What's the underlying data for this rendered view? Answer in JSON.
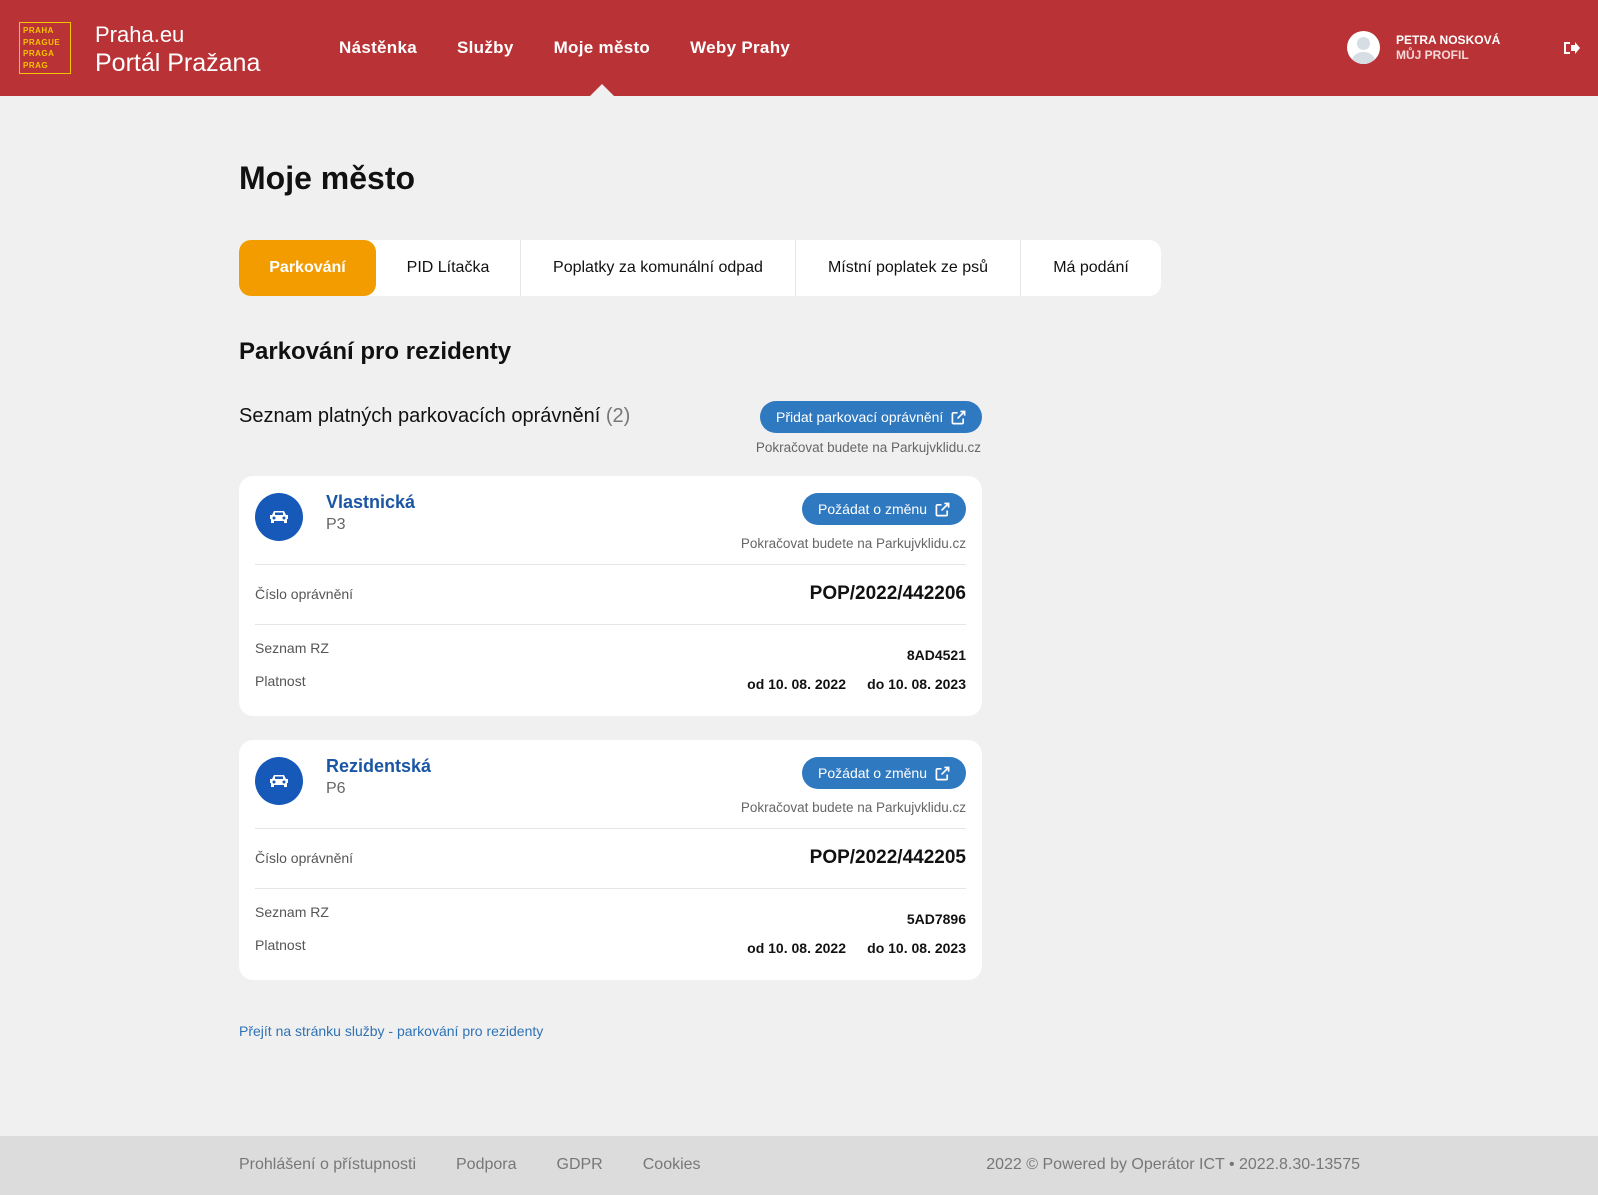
{
  "header": {
    "logo_lines": [
      "PRAHA",
      "PRAGUE",
      "PRAGA",
      "PRAG"
    ],
    "brand_line1": "Praha.eu",
    "brand_line2": "Portál Pražana",
    "nav": [
      "Nástěnka",
      "Služby",
      "Moje město",
      "Weby Prahy"
    ],
    "user_name": "PETRA NOSKOVÁ",
    "user_profile": "MŮJ PROFIL"
  },
  "main": {
    "title": "Moje město",
    "tabs": [
      "Parkování",
      "PID Lítačka",
      "Poplatky za komunální odpad",
      "Místní poplatek ze psů",
      "Má podání"
    ],
    "section_title": "Parkování pro rezidenty",
    "list_title": "Seznam platných parkovacích oprávnění",
    "list_count": "(2)",
    "add_button": "Přidat parkovací oprávnění",
    "continue_note": "Pokračovat budete na Parkujvklidu.cz",
    "permits": [
      {
        "type": "Vlastnická",
        "zone": "P3",
        "change_button": "Požádat o změnu",
        "note": "Pokračovat budete na Parkujvklidu.cz",
        "number_label": "Číslo oprávnění",
        "number": "POP/2022/442206",
        "rz_label": "Seznam RZ",
        "rz": "8AD4521",
        "validity_label": "Platnost",
        "valid_from": "od 10. 08. 2022",
        "valid_to": "do 10. 08. 2023"
      },
      {
        "type": "Rezidentská",
        "zone": "P6",
        "change_button": "Požádat o změnu",
        "note": "Pokračovat budete na Parkujvklidu.cz",
        "number_label": "Číslo oprávnění",
        "number": "POP/2022/442205",
        "rz_label": "Seznam RZ",
        "rz": "5AD7896",
        "validity_label": "Platnost",
        "valid_from": "od 10. 08. 2022",
        "valid_to": "do 10. 08. 2023"
      }
    ],
    "service_link": "Přejít na stránku služby - parkování pro rezidenty"
  },
  "footer": {
    "links": [
      "Prohlášení o přístupnosti",
      "Podpora",
      "GDPR",
      "Cookies"
    ],
    "copyright": "2022 © Powered by Operátor ICT • 2022.8.30-13575"
  },
  "colors": {
    "header_bg": "#b93336",
    "active_tab": "#f39c00",
    "button": "#2f79c1",
    "car_icon_bg": "#1759b9"
  }
}
